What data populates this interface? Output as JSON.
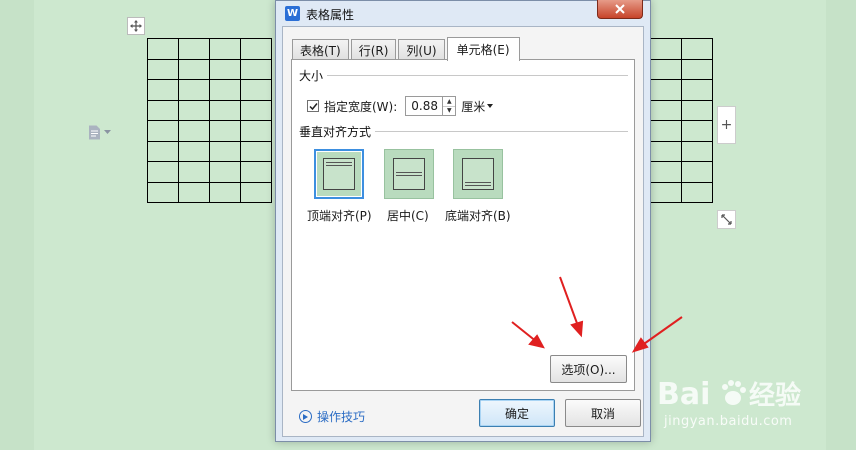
{
  "dialog": {
    "title": "表格属性",
    "app_icon_letter": "W",
    "tabs": [
      {
        "label": "表格(T)",
        "active": false
      },
      {
        "label": "行(R)",
        "active": false
      },
      {
        "label": "列(U)",
        "active": false
      },
      {
        "label": "单元格(E)",
        "active": true
      }
    ],
    "size_group": {
      "label": "大小",
      "width_checkbox_label": "指定宽度(W):",
      "width_checked": true,
      "width_value": "0.88",
      "unit": "厘米"
    },
    "valign_group": {
      "label": "垂直对齐方式",
      "options": [
        {
          "label": "顶端对齐(P)",
          "selected": true
        },
        {
          "label": "居中(C)",
          "selected": false
        },
        {
          "label": "底端对齐(B)",
          "selected": false
        }
      ]
    },
    "options_button": "选项(O)...",
    "tips_link": "操作技巧",
    "ok_button": "确定",
    "cancel_button": "取消"
  },
  "document": {
    "table_rows": 8,
    "left_columns": 4,
    "right_columns": 2
  },
  "watermark": {
    "brand": "Bai",
    "brand_suffix": "du",
    "product": "经验",
    "url": "jingyan.baidu.com"
  },
  "colors": {
    "page_background": "#cde8cf",
    "dialog_frame": "#dfe9f5",
    "selected_border": "#3d8fe0",
    "annotation_arrow": "#e02020",
    "link": "#2b6cc4"
  }
}
